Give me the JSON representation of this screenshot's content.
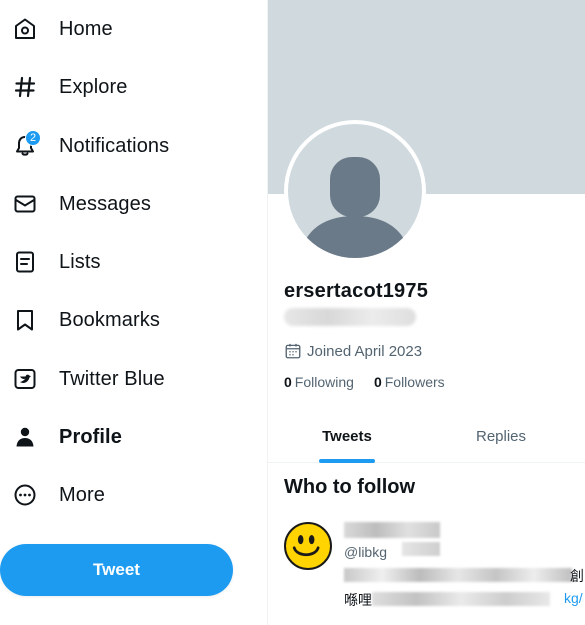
{
  "nav": {
    "items": [
      {
        "key": "home",
        "label": "Home",
        "icon": "home-icon"
      },
      {
        "key": "explore",
        "label": "Explore",
        "icon": "hashtag-icon"
      },
      {
        "key": "notifications",
        "label": "Notifications",
        "icon": "bell-icon",
        "badge": "2"
      },
      {
        "key": "messages",
        "label": "Messages",
        "icon": "envelope-icon"
      },
      {
        "key": "lists",
        "label": "Lists",
        "icon": "list-icon"
      },
      {
        "key": "bookmarks",
        "label": "Bookmarks",
        "icon": "bookmark-icon"
      },
      {
        "key": "twitter_blue",
        "label": "Twitter Blue",
        "icon": "twitter-blue-icon"
      },
      {
        "key": "profile",
        "label": "Profile",
        "icon": "person-icon",
        "active": true
      },
      {
        "key": "more",
        "label": "More",
        "icon": "more-circle-icon"
      }
    ],
    "tweet_button": "Tweet"
  },
  "profile": {
    "username": "ersertacot1975",
    "joined": "Joined April 2023",
    "following_count": "0",
    "following_label": "Following",
    "followers_count": "0",
    "followers_label": "Followers"
  },
  "tabs": [
    {
      "label": "Tweets",
      "active": true
    },
    {
      "label": "Replies",
      "active": false
    }
  ],
  "who_to_follow": {
    "title": "Who to follow",
    "suggestion": {
      "handle_prefix": "@libkg",
      "bio_trailing": "創",
      "bio2_prefix": "喺哩",
      "bio2_link": "kg/"
    }
  },
  "colors": {
    "accent": "#1d9bf0",
    "banner": "#cfd9de",
    "avatar_silhouette": "#6b7a88",
    "text_primary": "#0f1419",
    "text_secondary": "#536471",
    "smiley": "#ffd400"
  }
}
